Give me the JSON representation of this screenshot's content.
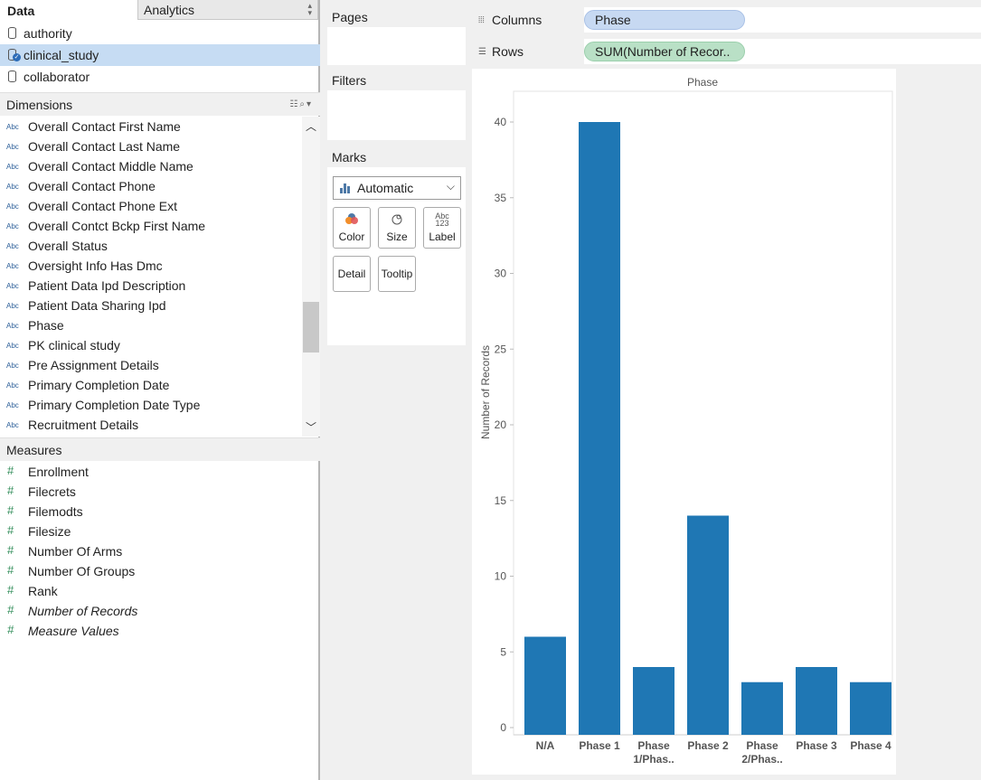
{
  "tabs": {
    "data": "Data",
    "analytics": "Analytics"
  },
  "datasources": [
    {
      "label": "authority",
      "selected": false
    },
    {
      "label": "clinical_study",
      "selected": true
    },
    {
      "label": "collaborator",
      "selected": false
    }
  ],
  "dimensions": {
    "header": "Dimensions",
    "type_icon": "Abc",
    "items": [
      "Overall Contact First Name",
      "Overall Contact Last Name",
      "Overall Contact Middle Name",
      "Overall Contact Phone",
      "Overall Contact Phone Ext",
      "Overall Contct Bckp First Name",
      "Overall Status",
      "Oversight Info Has Dmc",
      "Patient Data Ipd Description",
      "Patient Data Sharing Ipd",
      "Phase",
      "PK clinical study",
      "Pre Assignment Details",
      "Primary Completion Date",
      "Primary Completion Date Type",
      "Recruitment Details"
    ]
  },
  "measures": {
    "header": "Measures",
    "items": [
      {
        "label": "Enrollment",
        "italic": false
      },
      {
        "label": "Filecrets",
        "italic": false
      },
      {
        "label": "Filemodts",
        "italic": false
      },
      {
        "label": "Filesize",
        "italic": false
      },
      {
        "label": "Number Of Arms",
        "italic": false
      },
      {
        "label": "Number Of Groups",
        "italic": false
      },
      {
        "label": "Rank",
        "italic": false
      },
      {
        "label": "Number of Records",
        "italic": true
      },
      {
        "label": "Measure Values",
        "italic": true
      }
    ]
  },
  "cards": {
    "pages": "Pages",
    "filters": "Filters",
    "marks": "Marks",
    "mark_type": "Automatic",
    "buttons": {
      "color": "Color",
      "size": "Size",
      "label": "Label",
      "detail": "Detail",
      "tooltip": "Tooltip"
    },
    "label_icon_top": "Abc",
    "label_icon_bottom": "123"
  },
  "shelves": {
    "columns_label": "Columns",
    "columns_pill": "Phase",
    "rows_label": "Rows",
    "rows_pill": "SUM(Number of Recor.."
  },
  "chart_data": {
    "type": "bar",
    "title": "Phase",
    "ylabel": "Number of Records",
    "xlabel": "",
    "categories": [
      "N/A",
      "Phase 1",
      "Phase 1/Phas..",
      "Phase 2",
      "Phase 2/Phas..",
      "Phase 3",
      "Phase 4"
    ],
    "category_lines": [
      [
        "N/A"
      ],
      [
        "Phase 1"
      ],
      [
        "Phase",
        "1/Phas.."
      ],
      [
        "Phase 2"
      ],
      [
        "Phase",
        "2/Phas.."
      ],
      [
        "Phase 3"
      ],
      [
        "Phase 4"
      ]
    ],
    "values": [
      6,
      40,
      4,
      14,
      3,
      4,
      3
    ],
    "ylim": [
      0,
      42
    ],
    "yticks": [
      0,
      5,
      10,
      15,
      20,
      25,
      30,
      35,
      40
    ],
    "bar_color": "#1f77b4",
    "grid": false
  }
}
